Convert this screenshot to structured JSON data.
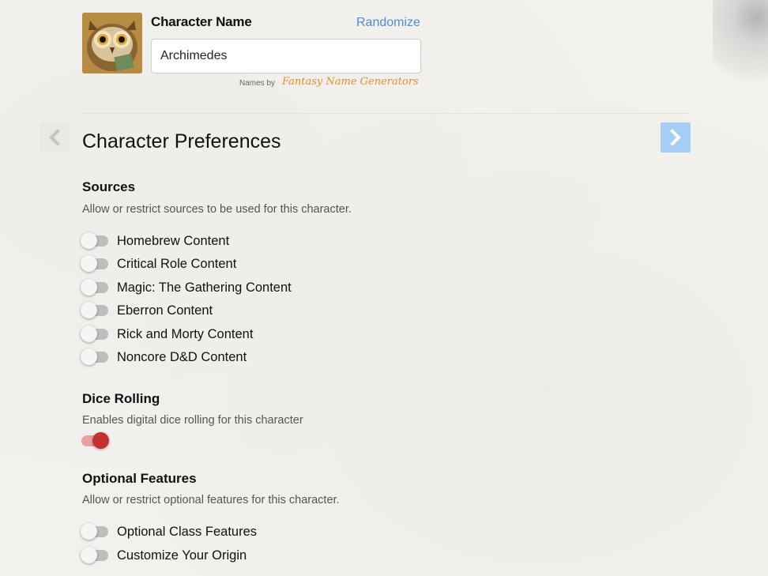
{
  "header": {
    "name_label": "Character Name",
    "randomize_label": "Randomize",
    "name_value": "Archimedes",
    "names_by": "Names by",
    "name_generator": "Fantasy Name Generators"
  },
  "main": {
    "title": "Character Preferences"
  },
  "sources": {
    "title": "Sources",
    "description": "Allow or restrict sources to be used for this character.",
    "items": [
      {
        "label": "Homebrew Content",
        "enabled": false
      },
      {
        "label": "Critical Role Content",
        "enabled": false
      },
      {
        "label": "Magic: The Gathering Content",
        "enabled": false
      },
      {
        "label": "Eberron Content",
        "enabled": false
      },
      {
        "label": "Rick and Morty Content",
        "enabled": false
      },
      {
        "label": "Noncore D&D Content",
        "enabled": false
      }
    ]
  },
  "dice": {
    "title": "Dice Rolling",
    "description": "Enables digital dice rolling for this character",
    "enabled": true
  },
  "optional": {
    "title": "Optional Features",
    "description": "Allow or restrict optional features for this character.",
    "items": [
      {
        "label": "Optional Class Features",
        "enabled": false
      },
      {
        "label": "Customize Your Origin",
        "enabled": false
      }
    ]
  },
  "icons": {
    "prev": "chevron-left-icon",
    "next": "chevron-right-icon",
    "avatar": "owl-portrait"
  },
  "colors": {
    "link": "#4a8fd6",
    "toggle_on": "#c53131",
    "next_button": "#a6cdf3"
  }
}
